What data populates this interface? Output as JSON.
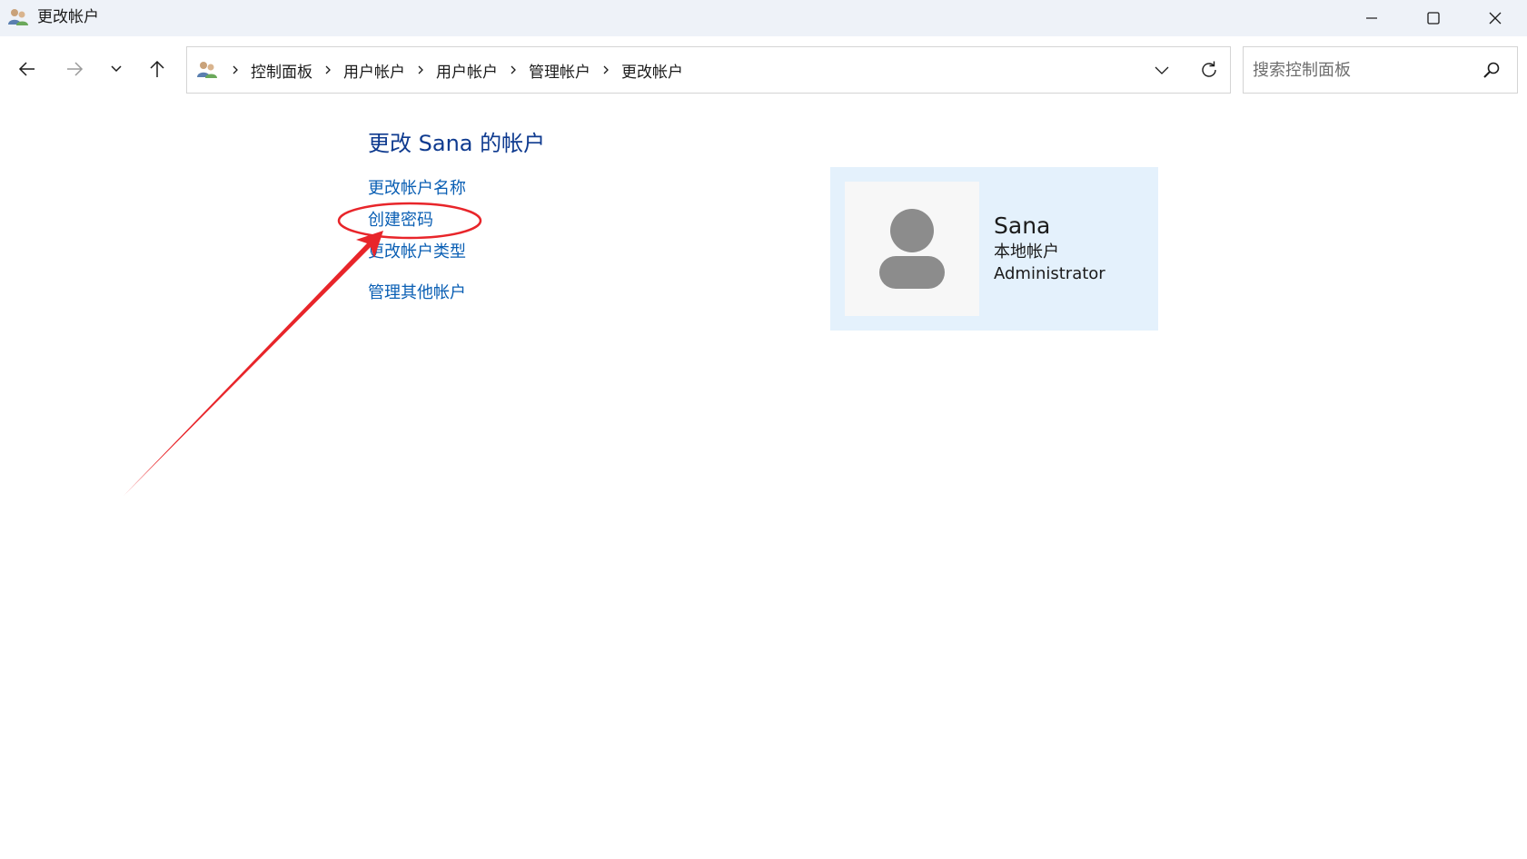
{
  "window": {
    "title": "更改帐户"
  },
  "address_bar": {
    "breadcrumbs": [
      "控制面板",
      "用户帐户",
      "用户帐户",
      "管理帐户",
      "更改帐户"
    ]
  },
  "search": {
    "placeholder": "搜索控制面板"
  },
  "main": {
    "title": "更改 Sana 的帐户",
    "links": {
      "rename": "更改帐户名称",
      "create_password": "创建密码",
      "change_type": "更改帐户类型",
      "manage_other": "管理其他帐户"
    }
  },
  "account": {
    "name": "Sana",
    "type": "本地帐户",
    "role": "Administrator"
  },
  "annotation": {
    "color": "#e8252a"
  },
  "colors": {
    "link": "#0a5fb4",
    "title": "#0e3a8f",
    "card_bg": "#e4f1fc"
  }
}
